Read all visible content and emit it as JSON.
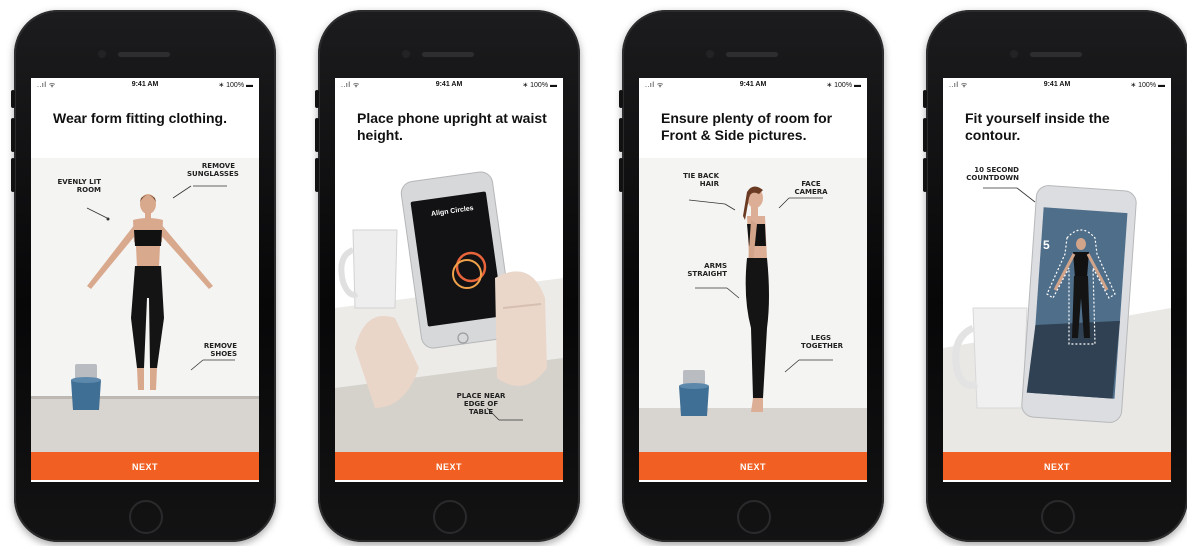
{
  "screens": [
    {
      "status": {
        "signal": "..ıl ᯤ",
        "time": "9:41 AM",
        "battery": "∗ 100% ▬"
      },
      "title": "Wear form fitting clothing.",
      "annotations": [
        "EVENLY LIT ROOM",
        "REMOVE SUNGLASSES",
        "REMOVE SHOES"
      ],
      "next_label": "NEXT"
    },
    {
      "status": {
        "signal": "..ıl ᯤ",
        "time": "9:41 AM",
        "battery": "∗ 100% ▬"
      },
      "title": "Place phone upright at waist height.",
      "annotations": [
        "PLACE NEAR EDGE OF TABLE"
      ],
      "inner_screen_title": "Align Circles",
      "next_label": "NEXT"
    },
    {
      "status": {
        "signal": "..ıl ᯤ",
        "time": "9:41 AM",
        "battery": "∗ 100% ▬"
      },
      "title": "Ensure plenty of room for Front & Side pictures.",
      "annotations": [
        "TIE BACK HAIR",
        "FACE CAMERA",
        "ARMS STRAIGHT",
        "LEGS TOGETHER"
      ],
      "next_label": "NEXT"
    },
    {
      "status": {
        "signal": "..ıl ᯤ",
        "time": "9:41 AM",
        "battery": "∗ 100% ▬"
      },
      "title": "Fit yourself inside the contour.",
      "annotations": [
        "10 SECOND COUNTDOWN"
      ],
      "countdown": "5",
      "next_label": "NEXT"
    }
  ],
  "colors": {
    "accent": "#f25f22",
    "phone_body": "#0a0a0b",
    "top_wear": "#111111",
    "mug": "#3f6f94"
  }
}
